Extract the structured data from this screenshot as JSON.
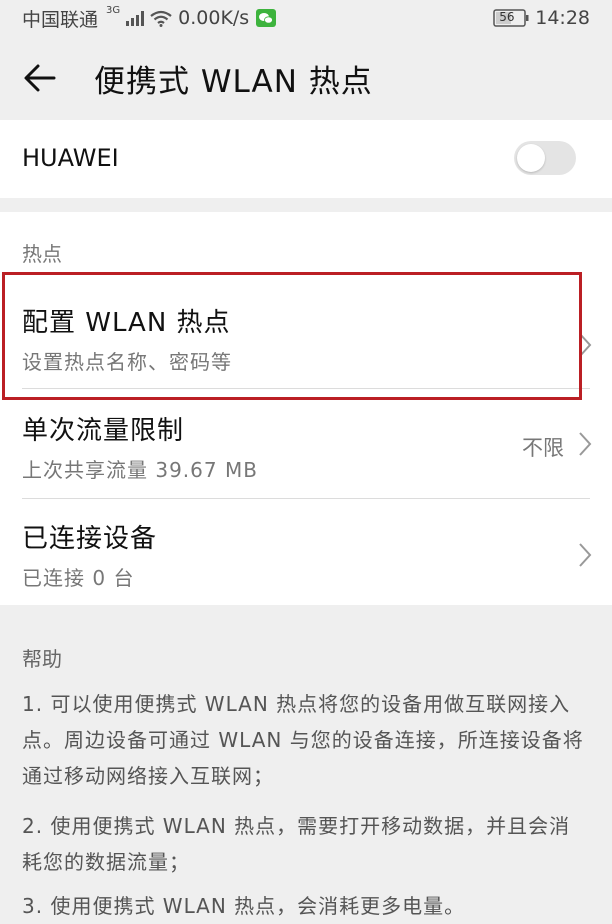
{
  "status_bar": {
    "carrier": "中国联通",
    "network": "3G",
    "speed": "0.00K/s",
    "battery": "56",
    "time": "14:28"
  },
  "app_bar": {
    "title": "便携式 WLAN 热点"
  },
  "hotspot": {
    "name": "HUAWEI",
    "enabled": false
  },
  "section_hotspot": {
    "header": "热点",
    "items": [
      {
        "title": "配置 WLAN 热点",
        "subtitle": "设置热点名称、密码等",
        "value": ""
      },
      {
        "title": "单次流量限制",
        "subtitle": "上次共享流量 39.67 MB",
        "value": "不限"
      },
      {
        "title": "已连接设备",
        "subtitle": "已连接 0 台",
        "value": ""
      }
    ]
  },
  "help": {
    "header": "帮助",
    "paragraphs": [
      "1. 可以使用便携式 WLAN 热点将您的设备用做互联网接入点。周边设备可通过 WLAN 与您的设备连接，所连接设备将通过移动网络接入互联网；",
      "2. 使用便携式 WLAN 热点，需要打开移动数据，并且会消耗您的数据流量；",
      "3. 使用便携式 WLAN 热点，会消耗更多电量。"
    ]
  },
  "colors": {
    "highlight_border": "#bb1f24",
    "background": "#efefef",
    "card": "#ffffff"
  }
}
